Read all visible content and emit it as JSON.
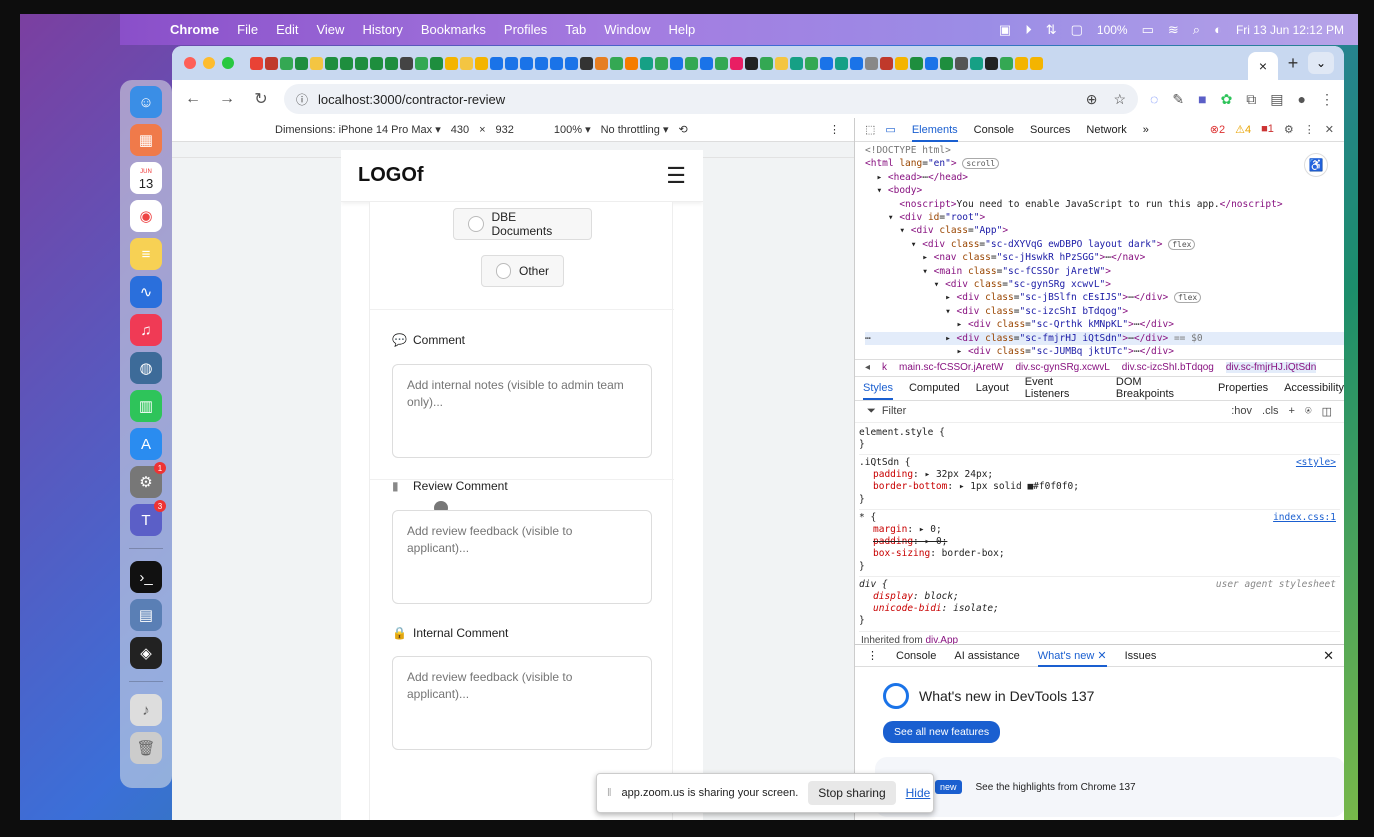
{
  "menubar": {
    "apple": "",
    "app": "Chrome",
    "items": [
      "File",
      "Edit",
      "View",
      "History",
      "Bookmarks",
      "Profiles",
      "Tab",
      "Window",
      "Help"
    ],
    "battery": "100%",
    "clock": "Fri 13 Jun  12:12 PM"
  },
  "dock": {
    "calendar_month": "JUN",
    "calendar_day": "13",
    "settings_badge": "1",
    "teams_badge": "3"
  },
  "browser": {
    "tab_close": "×",
    "new_tab": "+",
    "url": "localhost:3000/contractor-review"
  },
  "devicebar": {
    "dimensions": "Dimensions: iPhone 14 Pro Max ▾",
    "width": "430",
    "x": "×",
    "height": "932",
    "zoom": "100% ▾",
    "throttle": "No throttling ▾"
  },
  "app": {
    "logo": "LOGOf",
    "options": [
      "DBE Documents",
      "Other"
    ],
    "comment_label": "Comment",
    "comment_placeholder": "Add internal notes (visible to admin team only)...",
    "review_label": "Review Comment",
    "review_placeholder": "Add review feedback (visible to applicant)...",
    "internal_label": "Internal Comment",
    "internal_placeholder": "Add review feedback (visible to applicant)..."
  },
  "devtools": {
    "tabs": [
      "Elements",
      "Console",
      "Sources",
      "Network",
      "»"
    ],
    "errors": "2",
    "warnings": "4",
    "issues": "1",
    "dom": {
      "doctype": "<!DOCTYPE html>",
      "noscript_text": "You need to enable JavaScript to run this app.",
      "scroll_pill": "scroll",
      "flex_pill": "flex",
      "eq": "== $0"
    },
    "breadcrumbs": [
      "k",
      "main.sc-fCSSOr.jAretW",
      "div.sc-gynSRg.xcwvL",
      "div.sc-izcShI.bTdqog",
      "div.sc-fmjrHJ.iQtSdn"
    ],
    "style_tabs": [
      "Styles",
      "Computed",
      "Layout",
      "Event Listeners",
      "DOM Breakpoints",
      "Properties",
      "Accessibility"
    ],
    "filter": "Filter",
    "filter_hov": ":hov",
    "filter_cls": ".cls",
    "rules": {
      "element_style": "element.style {",
      "close": "}",
      "sel1": ".iQtSdn {",
      "src1": "<style>",
      "p1a": "padding",
      "v1a": "▸ 32px 24px;",
      "p1b": "border-bottom",
      "v1b": "▸ 1px solid ■#f0f0f0;",
      "sel2": "* {",
      "src2": "index.css:1",
      "p2a": "margin",
      "v2a": "▸ 0;",
      "p2b": "padding",
      "v2b": "▸ 0;",
      "p2c": "box-sizing",
      "v2c": "border-box;",
      "sel3": "div {",
      "src3": "user agent stylesheet",
      "p3a": "display",
      "v3a": "block;",
      "p3b": "unicode-bidi",
      "v3b": "isolate;",
      "inherited": "Inherited from",
      "inherited_el": "div.App"
    },
    "drawer_tabs": [
      "Console",
      "AI assistance",
      "What's new",
      "Issues"
    ],
    "whatsnew_title": "What's new in DevTools 137",
    "whatsnew_btn": "See all new features",
    "card_new": "new",
    "card_text": "See the highlights from Chrome 137"
  },
  "zoom": {
    "text": "app.zoom.us is sharing your screen.",
    "stop": "Stop sharing",
    "hide": "Hide"
  }
}
